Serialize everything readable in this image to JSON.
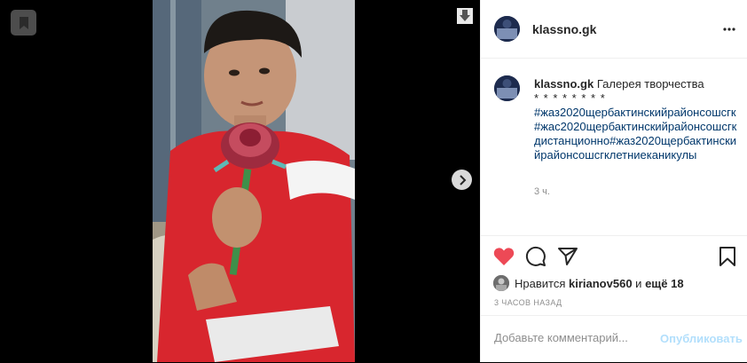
{
  "post": {
    "username": "klassno.gk",
    "caption_text": "Галерея творчества",
    "caption_stars": "* * * * * * * *",
    "caption_tags": "#жаз2020щербактинскийрайонсошсгк#жас2020щербактинскийрайонсошсгкдистанционно#жаз2020щербактинскийрайонсошсгклетниеканикулы",
    "time_ago": "3 ч.",
    "liked_by_prefix": "Нравится",
    "liked_by_user": "kirianov560",
    "liked_by_middle": "и",
    "liked_by_others": "ещё 18",
    "date_label": "3 ЧАСОВ НАЗАД"
  },
  "comment": {
    "placeholder": "Добавьте комментарий...",
    "post_label": "Опубликовать"
  },
  "colors": {
    "like_red": "#ed4956",
    "link_blue": "#00376b",
    "post_button_disabled": "#b2dffc"
  },
  "icons": [
    "bookmark-icon",
    "download-icon",
    "chevron-right-icon",
    "more-icon",
    "heart-icon",
    "comment-icon",
    "share-icon",
    "save-icon"
  ]
}
